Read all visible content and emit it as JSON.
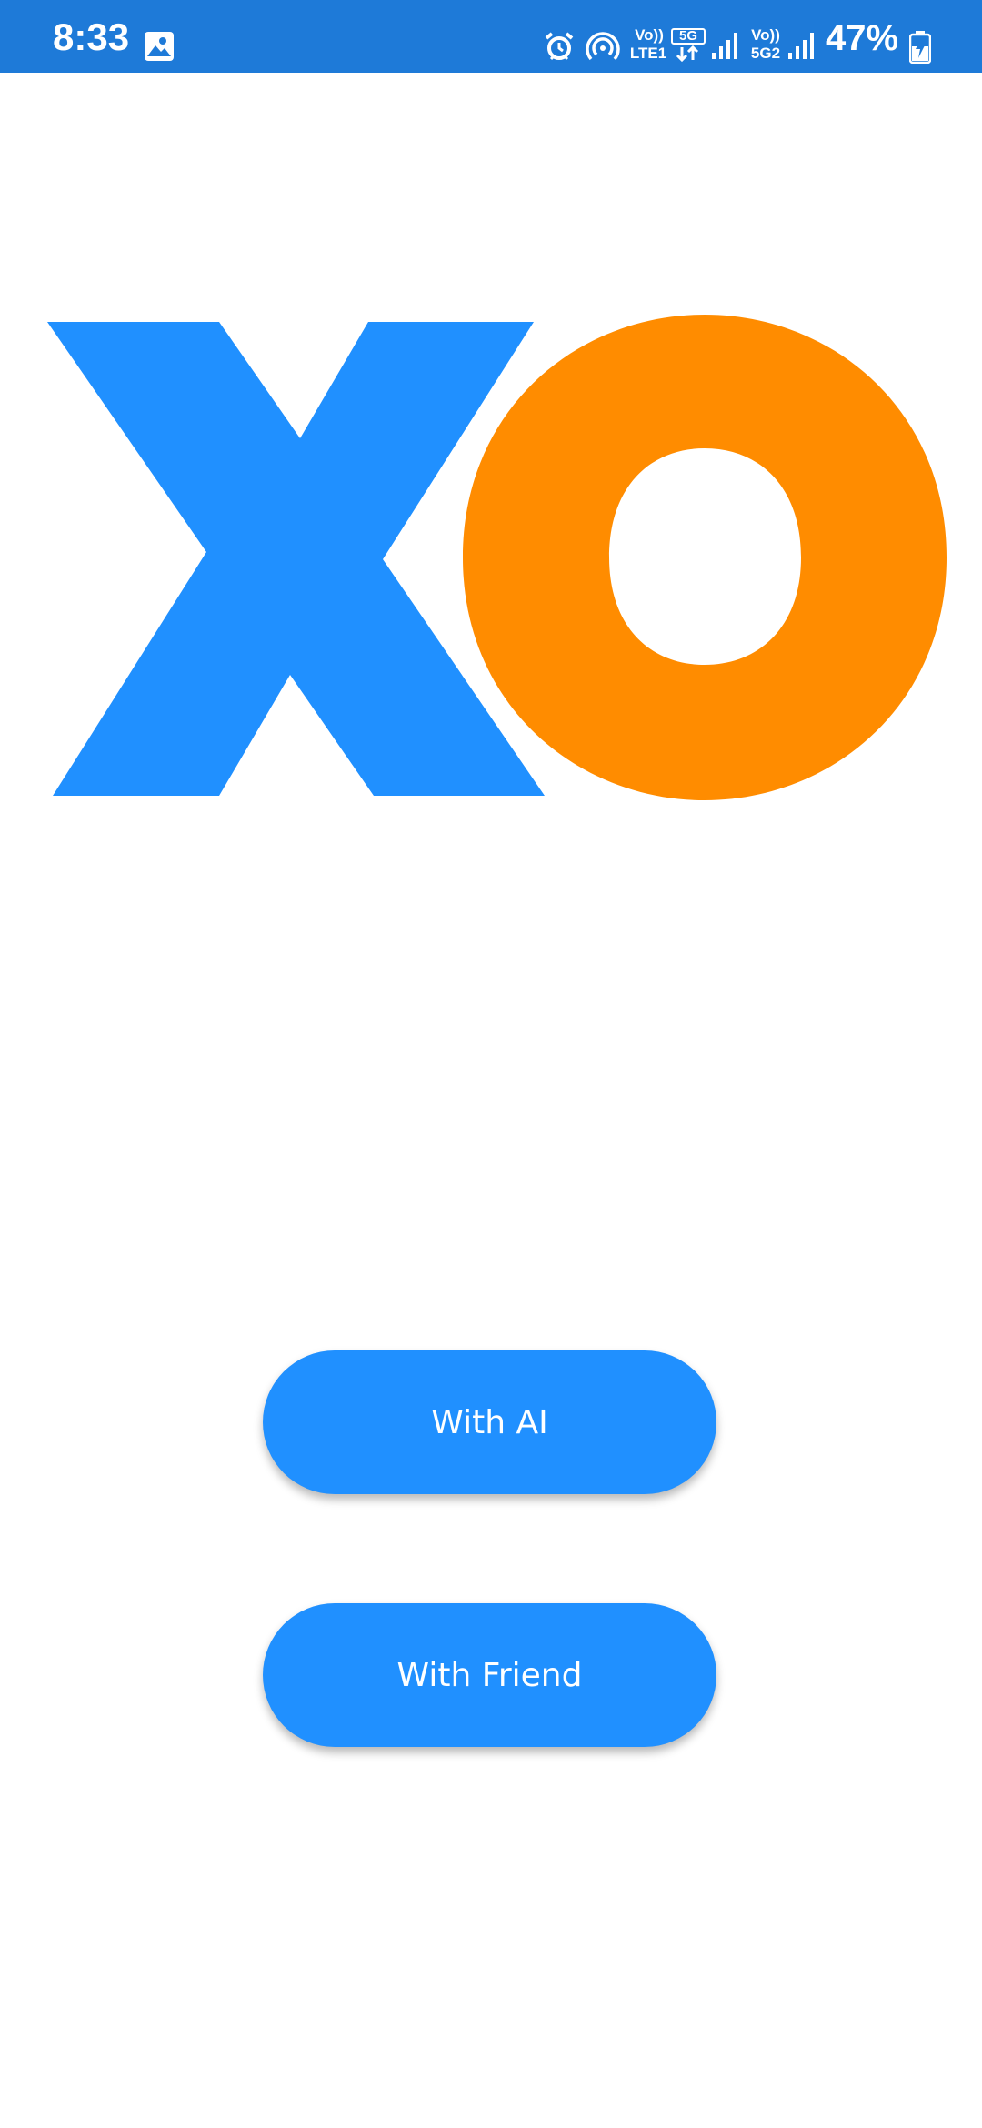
{
  "status_bar": {
    "time": "8:33",
    "battery_percent": "47%",
    "sim1_voice_top": "Vo))",
    "sim1_network": "LTE1",
    "network_5g": "5G",
    "sim2_voice_top": "Vo))",
    "sim2_network": "5G2",
    "background_color": "#1E7AD8",
    "icons": [
      "gallery-icon",
      "alarm-icon",
      "hotspot-icon",
      "data-transfer-icon",
      "signal-icon",
      "signal-icon",
      "battery-charging-icon"
    ]
  },
  "logo": {
    "x_color": "#2090FF",
    "o_color": "#FF8C00"
  },
  "buttons": {
    "with_ai": "With AI",
    "with_friend": "With Friend",
    "color": "#2090FF"
  }
}
